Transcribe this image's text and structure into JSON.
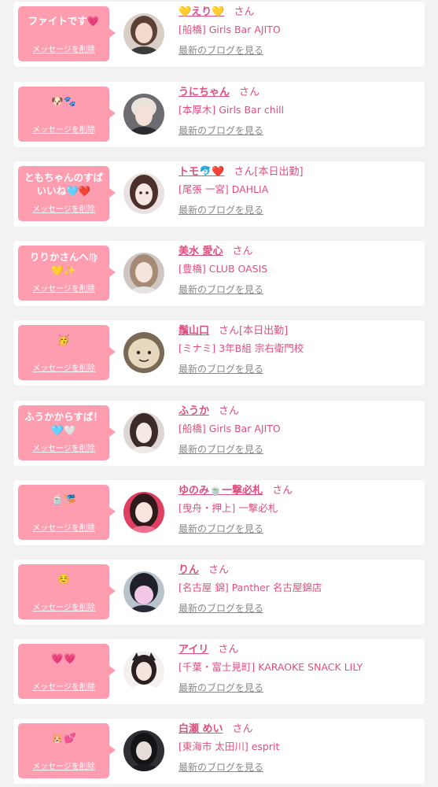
{
  "delete_label": "メッセージを削除",
  "san_label": "さん",
  "blog_label": "最新のブログを見る",
  "colors": {
    "bubble": "#fe9db0",
    "accent_text": "#dd4f82",
    "muted_text": "#888888",
    "page_bg": "#f2f2f2"
  },
  "items": [
    {
      "message": "ファイトです💗",
      "name": "💛えり💛",
      "status": "",
      "shop": "[船橋] Girls Bar AJITO",
      "avatar_icon": "avatar-photo-icon"
    },
    {
      "message": "🐶🐾",
      "name": "うにちゃん",
      "status": "",
      "shop": "[本厚木] Girls Bar chill",
      "avatar_icon": "avatar-photo-icon"
    },
    {
      "message": "ともちゃんのすば\nいいね🩵❤️",
      "name": "トモ🐬❤️",
      "status": "[本日出勤]",
      "shop": "[尾張 一宮] DAHLIA",
      "avatar_icon": "avatar-photo-icon"
    },
    {
      "message": "りりかさんへ♍\n💛✨",
      "name": "美水 愛心",
      "status": "",
      "shop": "[豊橋] CLUB OASIS",
      "avatar_icon": "avatar-photo-icon"
    },
    {
      "message": "🥳",
      "name": "鬚山口",
      "status": "[本日出勤]",
      "shop": "[ミナミ] 3年B組 宗右衛門校",
      "avatar_icon": "avatar-photo-icon"
    },
    {
      "message": "ふうかからすば！\n🩵🤍",
      "name": "ふうか",
      "status": "",
      "shop": "[船橋] Girls Bar AJITO",
      "avatar_icon": "avatar-photo-icon"
    },
    {
      "message": "🍵🎏",
      "name": "ゆのみ🍵一撃必札",
      "status": "",
      "shop": "[曳舟・押上] 一撃必札",
      "avatar_icon": "avatar-photo-icon"
    },
    {
      "message": "☺️",
      "name": "りん",
      "status": "",
      "shop": "[名古屋 錦] Panther 名古屋錦店",
      "avatar_icon": "avatar-photo-icon"
    },
    {
      "message": "💗💗",
      "name": "アイリ",
      "status": "",
      "shop": "[千葉・富士見町] KARAOKE SNACK LILY",
      "avatar_icon": "avatar-photo-icon"
    },
    {
      "message": "🐹💕",
      "name": "白瀬 めい",
      "status": "",
      "shop": "[東海市 太田川] esprit",
      "avatar_icon": "avatar-photo-icon"
    }
  ]
}
